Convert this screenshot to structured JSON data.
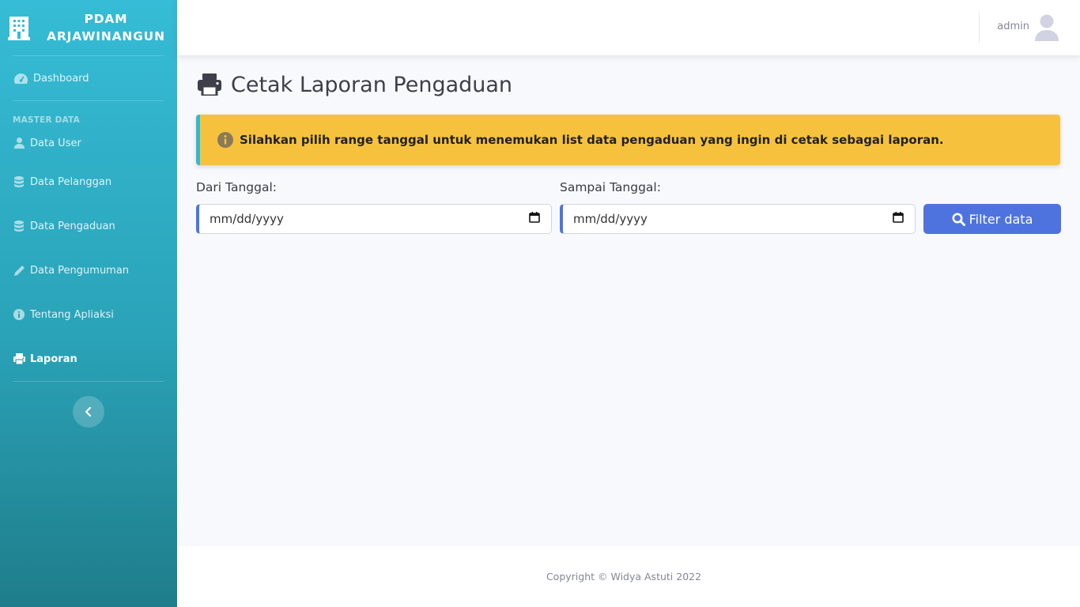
{
  "brand": {
    "line1": "PDAM",
    "line2": "ARJAWINANGUN",
    "icon": "building-icon"
  },
  "sidebar": {
    "dashboard": {
      "label": "Dashboard",
      "icon": "tachometer-icon"
    },
    "heading": "MASTER DATA",
    "items": [
      {
        "label": "Data User",
        "icon": "user-icon"
      },
      {
        "label": "Data Pelanggan",
        "icon": "database-icon"
      },
      {
        "label": "Data Pengaduan",
        "icon": "database-icon"
      },
      {
        "label": "Data Pengumuman",
        "icon": "pencil-icon"
      },
      {
        "label": "Tentang Apliaksi",
        "icon": "info-circle-icon"
      },
      {
        "label": "Laporan",
        "icon": "print-icon",
        "active": true
      }
    ],
    "toggle_icon": "chevron-left-icon"
  },
  "topbar": {
    "username": "admin",
    "avatar_icon": "user-avatar-icon"
  },
  "main": {
    "title": "Cetak Laporan Pengaduan",
    "title_icon": "print-icon",
    "alert": "Silahkan pilih range tanggal untuk menemukan list data pengaduan yang ingin di cetak sebagai laporan.",
    "from_label": "Dari Tanggal:",
    "from_value": "mm/dd/yyyy",
    "to_label": "Sampai Tanggal:",
    "to_value": "mm/dd/yyyy",
    "filter_button": "Filter data"
  },
  "footer": {
    "text": "Copyright © Widya Astuti 2022"
  },
  "colors": {
    "primary": "#4e73df",
    "warning": "#f6c23e",
    "info": "#36b9cc",
    "sidebar_top": "#36bcd6",
    "sidebar_bottom": "#1f7d8a"
  }
}
